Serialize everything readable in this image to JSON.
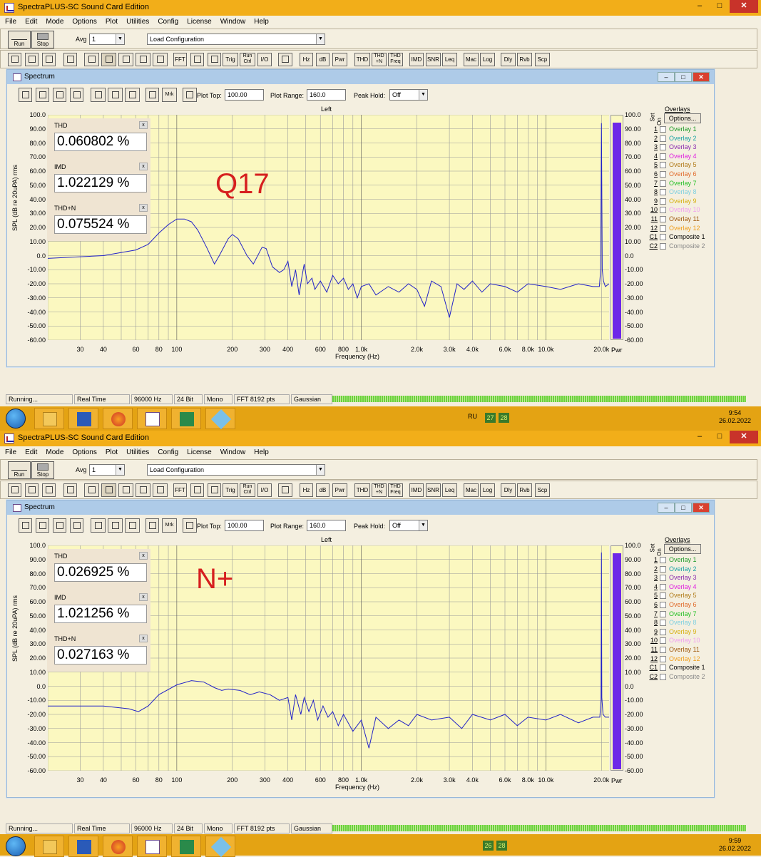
{
  "app_title": "SpectraPLUS-SC Sound Card Edition",
  "menu": [
    "File",
    "Edit",
    "Mode",
    "Options",
    "Plot",
    "Utilities",
    "Config",
    "License",
    "Window",
    "Help"
  ],
  "toolbar": {
    "run": "Run",
    "stop": "Stop",
    "avg_label": "Avg",
    "avg_value": "1",
    "config_value": "Load Configuration",
    "buttons": [
      "FFT",
      "Trig",
      "Run Ctrl",
      "I/O",
      "Hz",
      "dB",
      "Pwr",
      "THD",
      "THD +N",
      "THD Freq",
      "IMD",
      "SNR",
      "Leq",
      "Mac",
      "Log",
      "Dly",
      "Rvb",
      "Scp"
    ]
  },
  "spectrum": {
    "title": "Spectrum",
    "plot_top_label": "Plot Top:",
    "plot_top": "100.00",
    "plot_range_label": "Plot Range:",
    "plot_range": "160.0",
    "peak_hold_label": "Peak Hold:",
    "peak_hold": "Off",
    "mrk": "Mrk",
    "channel": "Left",
    "x_label": "Frequency (Hz)",
    "y_label": "SPL (dB re 20uPA) rms",
    "pwr": "Pwr",
    "y_ticks": [
      "100.0",
      "90.00",
      "80.00",
      "70.00",
      "60.00",
      "50.00",
      "40.00",
      "30.00",
      "20.00",
      "10.00",
      "0.0",
      "-10.00",
      "-20.00",
      "-30.00",
      "-40.00",
      "-50.00",
      "-60.00"
    ],
    "x_ticks": [
      "30",
      "40",
      "60",
      "80",
      "100",
      "200",
      "300",
      "400",
      "600",
      "800",
      "1.0k",
      "2.0k",
      "3.0k",
      "4.0k",
      "6.0k",
      "8.0k",
      "10.0k",
      "20.0k"
    ]
  },
  "overlays": {
    "header": "Overlays",
    "options": "Options...",
    "set": "Set",
    "on": "On",
    "items": [
      {
        "n": "1",
        "label": "Overlay 1",
        "color": "#1d9a28"
      },
      {
        "n": "2",
        "label": "Overlay 2",
        "color": "#1aa3a3"
      },
      {
        "n": "3",
        "label": "Overlay 3",
        "color": "#8a2bb0"
      },
      {
        "n": "4",
        "label": "Overlay 4",
        "color": "#e020e0"
      },
      {
        "n": "5",
        "label": "Overlay 5",
        "color": "#b07a18"
      },
      {
        "n": "6",
        "label": "Overlay 6",
        "color": "#e06a2a"
      },
      {
        "n": "7",
        "label": "Overlay 7",
        "color": "#24c024"
      },
      {
        "n": "8",
        "label": "Overlay 8",
        "color": "#7fd0e0"
      },
      {
        "n": "9",
        "label": "Overlay 9",
        "color": "#d6b010"
      },
      {
        "n": "10",
        "label": "Overlay 10",
        "color": "#f0a0f0"
      },
      {
        "n": "11",
        "label": "Overlay 11",
        "color": "#a05a10"
      },
      {
        "n": "12",
        "label": "Overlay 12",
        "color": "#f0a020"
      },
      {
        "n": "C1",
        "label": "Composite 1",
        "color": "#000000"
      },
      {
        "n": "C2",
        "label": "Composite 2",
        "color": "#888888"
      }
    ]
  },
  "status": {
    "state": "Running...",
    "mode": "Real Time",
    "rate": "96000 Hz",
    "bits": "24 Bit",
    "channels": "Mono",
    "fft": "FFT 8192 pts",
    "window": "Gaussian"
  },
  "taskbar": {
    "lang": "RU"
  },
  "windows": [
    {
      "label": "Q17",
      "thd_label": "THD",
      "thd": "0.060802 %",
      "imd_label": "IMD",
      "imd": "1.022129 %",
      "thdn_label": "THD+N",
      "thdn": "0.075524 %",
      "tray_num1": "27",
      "tray_num2": "28",
      "time": "9:54",
      "date": "26.02.2022"
    },
    {
      "label": "N+",
      "thd_label": "THD",
      "thd": "0.026925 %",
      "imd_label": "IMD",
      "imd": "1.021256 %",
      "thdn_label": "THD+N",
      "thdn": "0.027163 %",
      "tray_num1": "26",
      "tray_num2": "28",
      "time": "9:59",
      "date": "26.02.2022"
    }
  ],
  "spectra": [
    {
      "points": [
        [
          20,
          -2
        ],
        [
          40,
          0
        ],
        [
          60,
          4
        ],
        [
          70,
          8
        ],
        [
          80,
          16
        ],
        [
          90,
          22
        ],
        [
          100,
          26
        ],
        [
          110,
          26
        ],
        [
          120,
          24
        ],
        [
          130,
          18
        ],
        [
          145,
          6
        ],
        [
          160,
          -6
        ],
        [
          170,
          0
        ],
        [
          190,
          12
        ],
        [
          200,
          15
        ],
        [
          215,
          12
        ],
        [
          240,
          0
        ],
        [
          260,
          -6
        ],
        [
          290,
          6
        ],
        [
          305,
          5
        ],
        [
          330,
          -8
        ],
        [
          360,
          -12
        ],
        [
          380,
          -10
        ],
        [
          400,
          -4
        ],
        [
          420,
          -22
        ],
        [
          440,
          -10
        ],
        [
          460,
          -28
        ],
        [
          475,
          -16
        ],
        [
          490,
          -6
        ],
        [
          510,
          -20
        ],
        [
          540,
          -16
        ],
        [
          560,
          -24
        ],
        [
          600,
          -18
        ],
        [
          650,
          -26
        ],
        [
          700,
          -14
        ],
        [
          750,
          -20
        ],
        [
          800,
          -16
        ],
        [
          850,
          -24
        ],
        [
          900,
          -20
        ],
        [
          950,
          -30
        ],
        [
          1000,
          -22
        ],
        [
          1100,
          -20
        ],
        [
          1200,
          -28
        ],
        [
          1400,
          -22
        ],
        [
          1600,
          -26
        ],
        [
          1800,
          -20
        ],
        [
          2000,
          -24
        ],
        [
          2200,
          -36
        ],
        [
          2400,
          -18
        ],
        [
          2700,
          -22
        ],
        [
          3000,
          -44
        ],
        [
          3300,
          -20
        ],
        [
          3600,
          -24
        ],
        [
          4000,
          -18
        ],
        [
          4500,
          -26
        ],
        [
          5000,
          -20
        ],
        [
          6000,
          -22
        ],
        [
          7000,
          -26
        ],
        [
          8000,
          -20
        ],
        [
          10000,
          -22
        ],
        [
          12000,
          -24
        ],
        [
          15000,
          -20
        ],
        [
          18000,
          -22
        ],
        [
          19500,
          -22
        ],
        [
          19800,
          -10
        ],
        [
          20000,
          94
        ],
        [
          20200,
          -10
        ],
        [
          20500,
          -18
        ],
        [
          21000,
          -22
        ],
        [
          22000,
          -20
        ]
      ]
    },
    {
      "points": [
        [
          20,
          -14
        ],
        [
          40,
          -14
        ],
        [
          55,
          -16
        ],
        [
          62,
          -18
        ],
        [
          70,
          -14
        ],
        [
          80,
          -6
        ],
        [
          100,
          1
        ],
        [
          120,
          4
        ],
        [
          140,
          3
        ],
        [
          160,
          -1
        ],
        [
          175,
          -3
        ],
        [
          190,
          -2
        ],
        [
          220,
          -3
        ],
        [
          250,
          -6
        ],
        [
          280,
          -4
        ],
        [
          320,
          -6
        ],
        [
          360,
          -10
        ],
        [
          400,
          -8
        ],
        [
          420,
          -24
        ],
        [
          440,
          -6
        ],
        [
          470,
          -20
        ],
        [
          490,
          -8
        ],
        [
          520,
          -18
        ],
        [
          550,
          -10
        ],
        [
          580,
          -24
        ],
        [
          620,
          -14
        ],
        [
          660,
          -22
        ],
        [
          700,
          -18
        ],
        [
          750,
          -28
        ],
        [
          800,
          -20
        ],
        [
          900,
          -32
        ],
        [
          1000,
          -24
        ],
        [
          1100,
          -44
        ],
        [
          1200,
          -22
        ],
        [
          1400,
          -30
        ],
        [
          1600,
          -24
        ],
        [
          1800,
          -28
        ],
        [
          2000,
          -20
        ],
        [
          2400,
          -24
        ],
        [
          3000,
          -22
        ],
        [
          3500,
          -30
        ],
        [
          4000,
          -20
        ],
        [
          5000,
          -24
        ],
        [
          6000,
          -20
        ],
        [
          7000,
          -28
        ],
        [
          8000,
          -22
        ],
        [
          10000,
          -24
        ],
        [
          12000,
          -20
        ],
        [
          15000,
          -26
        ],
        [
          18000,
          -22
        ],
        [
          19600,
          -22
        ],
        [
          19900,
          -10
        ],
        [
          20000,
          95
        ],
        [
          20100,
          -8
        ],
        [
          20400,
          -20
        ],
        [
          21000,
          -22
        ],
        [
          22000,
          -22
        ]
      ]
    }
  ]
}
